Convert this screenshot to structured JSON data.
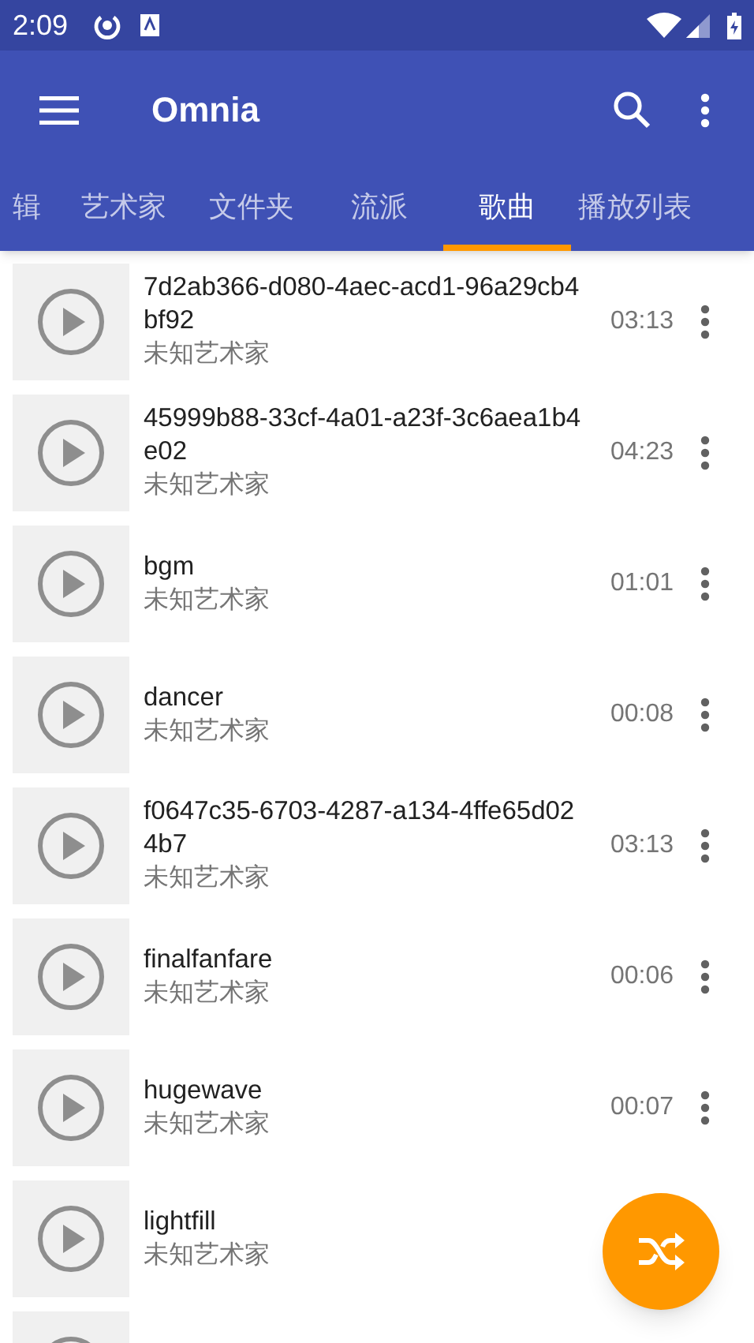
{
  "status_bar": {
    "time": "2:09"
  },
  "app_bar": {
    "title": "Omnia"
  },
  "tabs": [
    {
      "label": "辑",
      "selected": false
    },
    {
      "label": "艺术家",
      "selected": false
    },
    {
      "label": "文件夹",
      "selected": false
    },
    {
      "label": "流派",
      "selected": false
    },
    {
      "label": "歌曲",
      "selected": true
    },
    {
      "label": "播放列表",
      "selected": false
    }
  ],
  "songs": [
    {
      "title": "7d2ab366-d080-4aec-acd1-96a29cb4bf92",
      "artist": "未知艺术家",
      "duration": "03:13"
    },
    {
      "title": "45999b88-33cf-4a01-a23f-3c6aea1b4e02",
      "artist": "未知艺术家",
      "duration": "04:23"
    },
    {
      "title": "bgm",
      "artist": "未知艺术家",
      "duration": "01:01"
    },
    {
      "title": "dancer",
      "artist": "未知艺术家",
      "duration": "00:08"
    },
    {
      "title": "f0647c35-6703-4287-a134-4ffe65d024b7",
      "artist": "未知艺术家",
      "duration": "03:13"
    },
    {
      "title": "finalfanfare",
      "artist": "未知艺术家",
      "duration": "00:06"
    },
    {
      "title": "hugewave",
      "artist": "未知艺术家",
      "duration": "00:07"
    },
    {
      "title": "lightfill",
      "artist": "未知艺术家"
    }
  ]
}
